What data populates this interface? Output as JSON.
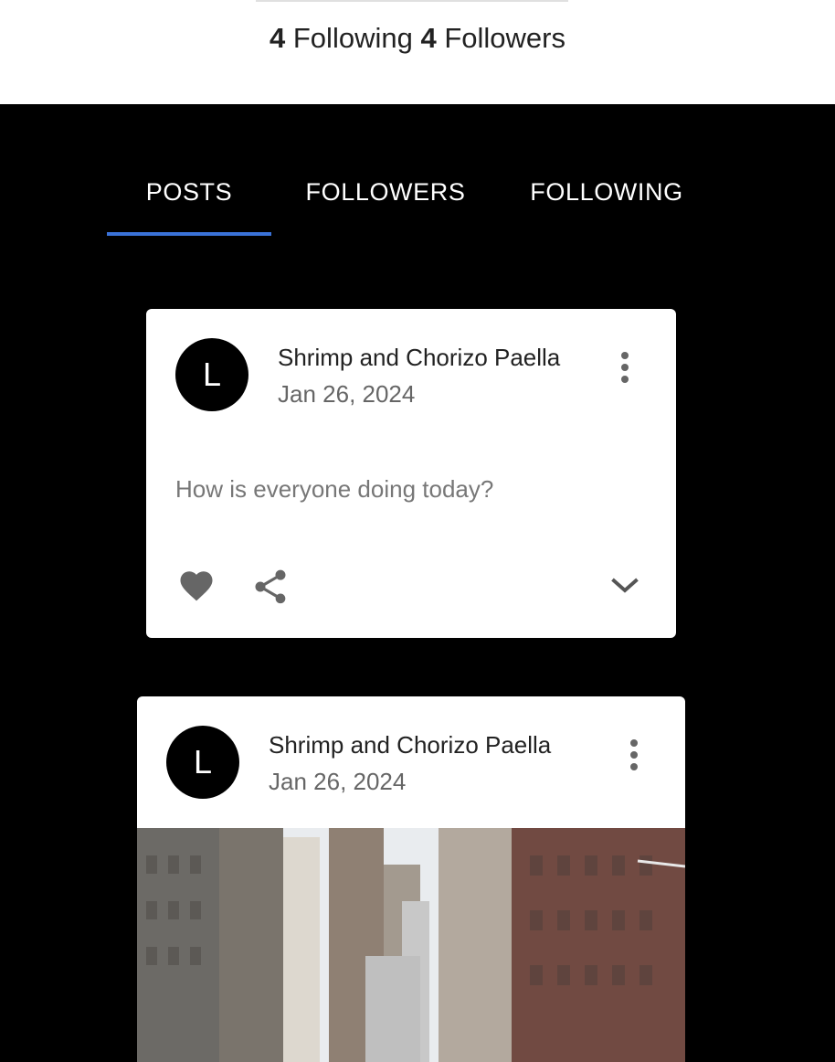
{
  "profile_stats": {
    "following_count": "4",
    "following_label": "Following",
    "followers_count": "4",
    "followers_label": "Followers"
  },
  "tabs": [
    {
      "label": "POSTS",
      "active": true
    },
    {
      "label": "FOLLOWERS",
      "active": false
    },
    {
      "label": "FOLLOWING",
      "active": false
    }
  ],
  "posts": [
    {
      "avatar_letter": "L",
      "title": "Shrimp and Chorizo Paella",
      "date": "Jan 26, 2024",
      "body": "How is everyone doing today?",
      "icons": [
        "more-vert-icon",
        "heart-icon",
        "share-icon",
        "chevron-down-icon"
      ]
    },
    {
      "avatar_letter": "L",
      "title": "Shrimp and Chorizo Paella",
      "date": "Jan 26, 2024",
      "image": "city-street-photo",
      "icons": [
        "more-vert-icon"
      ]
    }
  ],
  "colors": {
    "accent": "#3a72d8",
    "background": "#000000",
    "card": "#ffffff",
    "icon": "#666666"
  }
}
